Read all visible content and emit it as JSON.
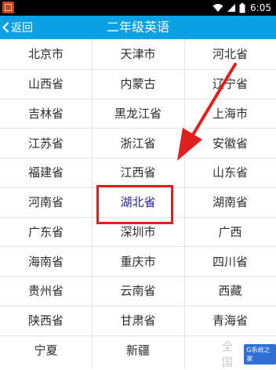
{
  "status_bar": {
    "time": "6:05",
    "icons": [
      "app-icon",
      "wifi-icon",
      "signal-icon",
      "battery-icon"
    ]
  },
  "header": {
    "back_label": "返回",
    "title": "二年级英语",
    "color": "#0aa0e4"
  },
  "provinces": [
    "北京市",
    "天津市",
    "河北省",
    "山西省",
    "内蒙古",
    "辽宁省",
    "吉林省",
    "黑龙江省",
    "上海市",
    "江苏省",
    "浙江省",
    "安徽省",
    "福建省",
    "江西省",
    "山东省",
    "河南省",
    "湖北省",
    "湖南省",
    "广东省",
    "深圳市",
    "广西",
    "海南省",
    "重庆市",
    "四川省",
    "贵州省",
    "云南省",
    "西藏",
    "陕西省",
    "甘肃省",
    "青海省",
    "宁夏",
    "新疆",
    "全国"
  ],
  "selected_province": "湖北省",
  "annotation": {
    "box_color": "#e01f1f",
    "arrow_color": "#e01f1f"
  },
  "watermark": {
    "text": "全国",
    "logo_text": "G系统之家"
  }
}
